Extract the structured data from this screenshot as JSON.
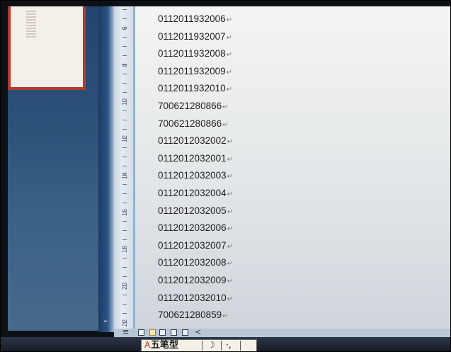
{
  "document": {
    "lines": [
      "0112011932006",
      "0112011932007",
      "0112011932008",
      "0112011932009",
      "0112011932010",
      "700621280866",
      "700621280866",
      "0112012032002",
      "0112012032001",
      "0112012032003",
      "0112012032004",
      "0112012032005",
      "0112012032006",
      "0112012032007",
      "0112012032008",
      "0112012032009",
      "0112012032010",
      "700621280859"
    ],
    "paragraph_mark": "↵"
  },
  "ruler": {
    "labels": [
      "6",
      "8",
      "10",
      "12",
      "14",
      "16",
      "18",
      "20",
      "22"
    ]
  },
  "scrollbar": {
    "arrow": "⌄"
  },
  "status_bar": {
    "view_buttons": [
      "print-layout",
      "full-screen-reading",
      "web-layout",
      "outline",
      "draft"
    ],
    "prev_page": "<"
  },
  "ime_toolbar": {
    "mode_icon": "A",
    "input_method": "五笔型",
    "moon_icon": "☽",
    "punct_icon": "·,"
  },
  "colors": {
    "taskbar": "#2c5178",
    "thumbnail_border": "#b23a2e",
    "page": "#eceeee",
    "ruler_accent": "#8fb3d8"
  }
}
